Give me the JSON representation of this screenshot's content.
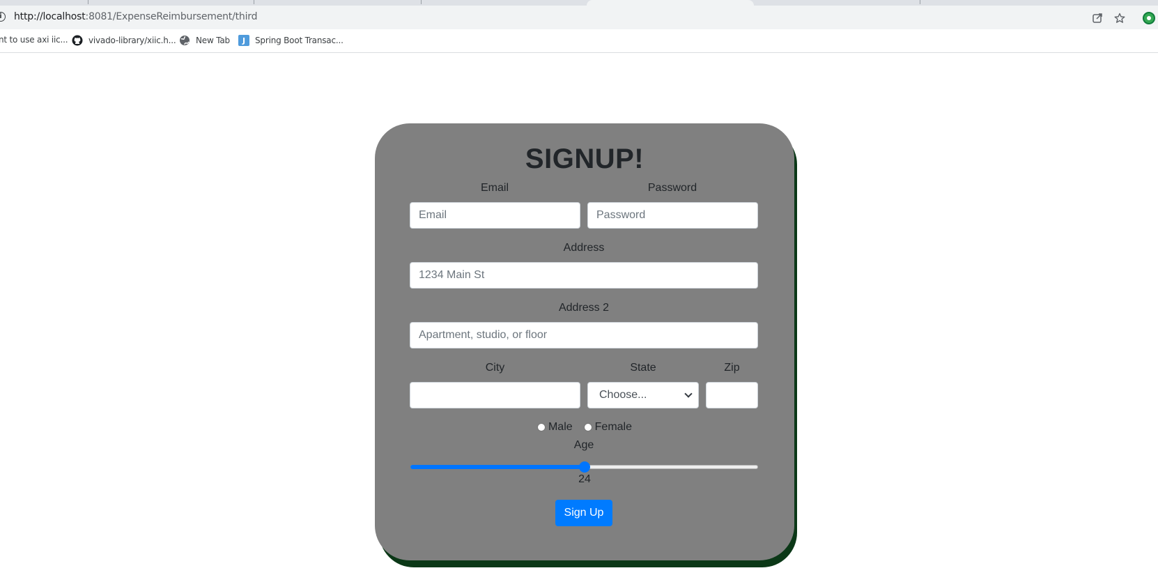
{
  "browser": {
    "url_host": "http://localhost",
    "url_rest": ":8081/ExpenseReimbursement/third",
    "bookmarks": [
      {
        "label": "nt to use axi iic...",
        "icon": "page-icon"
      },
      {
        "label": "vivado-library/xiic.h...",
        "icon": "github-icon"
      },
      {
        "label": "New Tab",
        "icon": "globe-icon"
      },
      {
        "label": "Spring Boot Transac...",
        "icon": "j-logo-icon"
      }
    ]
  },
  "form": {
    "title": "SIGNUP!",
    "email": {
      "label": "Email",
      "placeholder": "Email"
    },
    "password": {
      "label": "Password",
      "placeholder": "Password"
    },
    "address": {
      "label": "Address",
      "placeholder": "1234 Main St"
    },
    "address2": {
      "label": "Address 2",
      "placeholder": "Apartment, studio, or floor"
    },
    "city": {
      "label": "City",
      "placeholder": ""
    },
    "state": {
      "label": "State",
      "selected": "Choose..."
    },
    "zip": {
      "label": "Zip",
      "placeholder": ""
    },
    "gender": {
      "options": [
        "Male",
        "Female"
      ]
    },
    "age": {
      "label": "Age",
      "value": "24",
      "fraction": 0.5
    },
    "submit_label": "Sign Up"
  },
  "colors": {
    "card": "#808080",
    "card_shadow": "#0b3817",
    "accent": "#007bff",
    "text": "#212529"
  }
}
